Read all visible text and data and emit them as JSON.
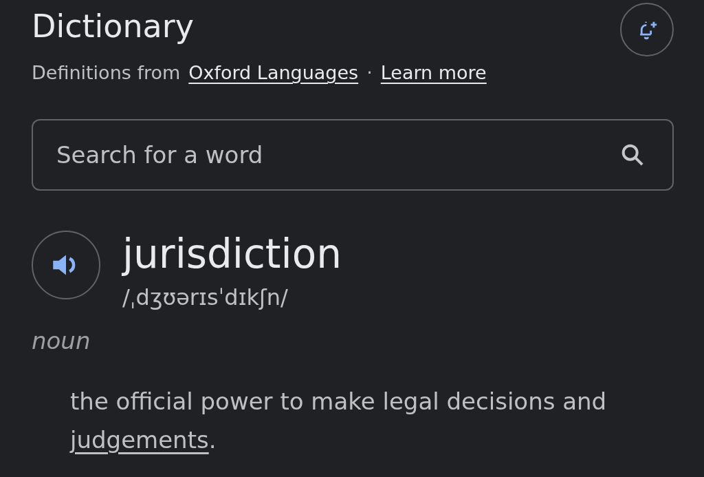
{
  "header": {
    "title": "Dictionary",
    "source_prefix": "Definitions from",
    "source_link": "Oxford Languages",
    "separator": "·",
    "learn_more": "Learn more"
  },
  "search": {
    "placeholder": "Search for a word"
  },
  "entry": {
    "word": "jurisdiction",
    "pronunciation": "/ˌdʒʊərɪsˈdɪkʃn/",
    "part_of_speech": "noun",
    "definition": {
      "before": "the official power to make legal decisions and ",
      "link": "judgements",
      "after": "."
    }
  }
}
